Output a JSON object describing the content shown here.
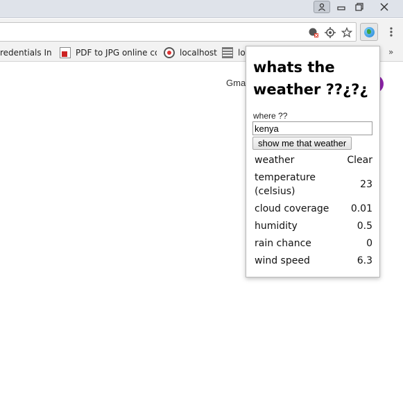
{
  "window_controls": {
    "profile_icon": "person-icon",
    "minimize_icon": "minimize-icon",
    "maximize_icon": "restore-icon",
    "close_icon": "close-icon"
  },
  "toolbar": {
    "omnibox_icons": [
      "blocked-location-icon",
      "target-icon",
      "star-icon"
    ],
    "extension_icon": "globe-icon",
    "menu_icon": "vertical-dots-icon"
  },
  "bookmarks": {
    "items": [
      {
        "label": "redentials In …",
        "icon": "bookmark-icon"
      },
      {
        "label": "PDF to JPG online co",
        "icon": "pdf-icon"
      },
      {
        "label": "localhost",
        "icon": "localhost-icon"
      },
      {
        "label": "lo",
        "icon": "doc-icon"
      }
    ],
    "overflow": "»"
  },
  "page": {
    "gmail_link": "Gma"
  },
  "popup": {
    "title": "whats the weather ??¿?¿",
    "where_label": "where ??",
    "where_value": "kenya",
    "submit_label": "show me that weather",
    "rows": [
      {
        "label": "weather",
        "value": "Clear"
      },
      {
        "label": "temperature (celsius)",
        "value": "23"
      },
      {
        "label": "cloud coverage",
        "value": "0.01"
      },
      {
        "label": "humidity",
        "value": "0.5"
      },
      {
        "label": "rain chance",
        "value": "0"
      },
      {
        "label": "wind speed",
        "value": "6.3"
      }
    ]
  },
  "colors": {
    "titlebar": "#dfe3ea",
    "toolbar": "#f2f2f2",
    "avatar": "#8e24aa"
  }
}
